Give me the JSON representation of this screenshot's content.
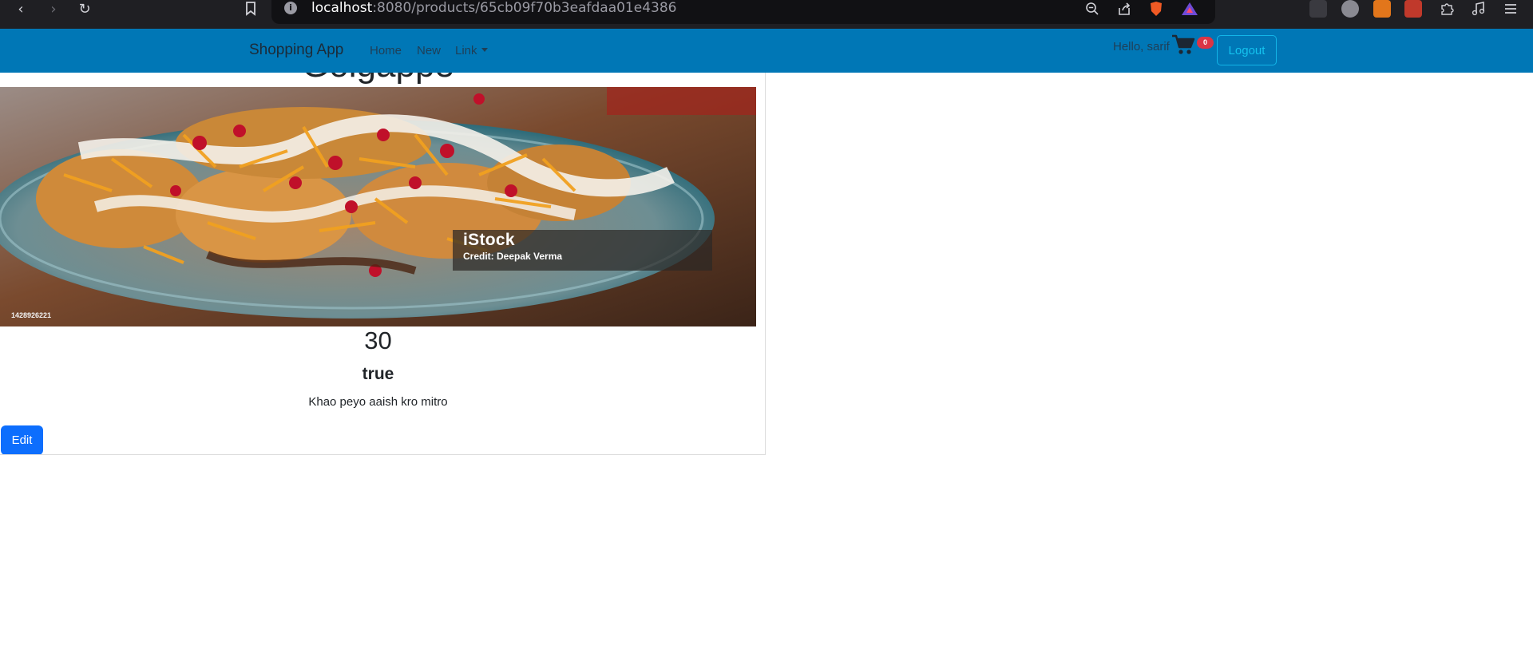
{
  "browser": {
    "url_host": "localhost",
    "url_rest": ":8080/products/65cb09f70b3eafdaa01e4386",
    "back_glyph": "‹",
    "forward_glyph": "›",
    "reload_glyph": "↻",
    "info_glyph": "i"
  },
  "navbar": {
    "brand": "Shopping App",
    "links": [
      "Home",
      "New",
      "Link"
    ],
    "greeting": "Hello, sarif",
    "cart_count": "0",
    "logout_label": "Logout",
    "bar_color": "#0077b6"
  },
  "product": {
    "title": "Golgappe",
    "watermark_brand": "iStock",
    "watermark_credit": "Credit: Deepak Verma",
    "watermark_id": "1428926221",
    "price": "30",
    "availability": "true",
    "description": "Khao peyo aaish kro mitro",
    "edit_label": "Edit",
    "edit_color": "#0d6efd"
  }
}
